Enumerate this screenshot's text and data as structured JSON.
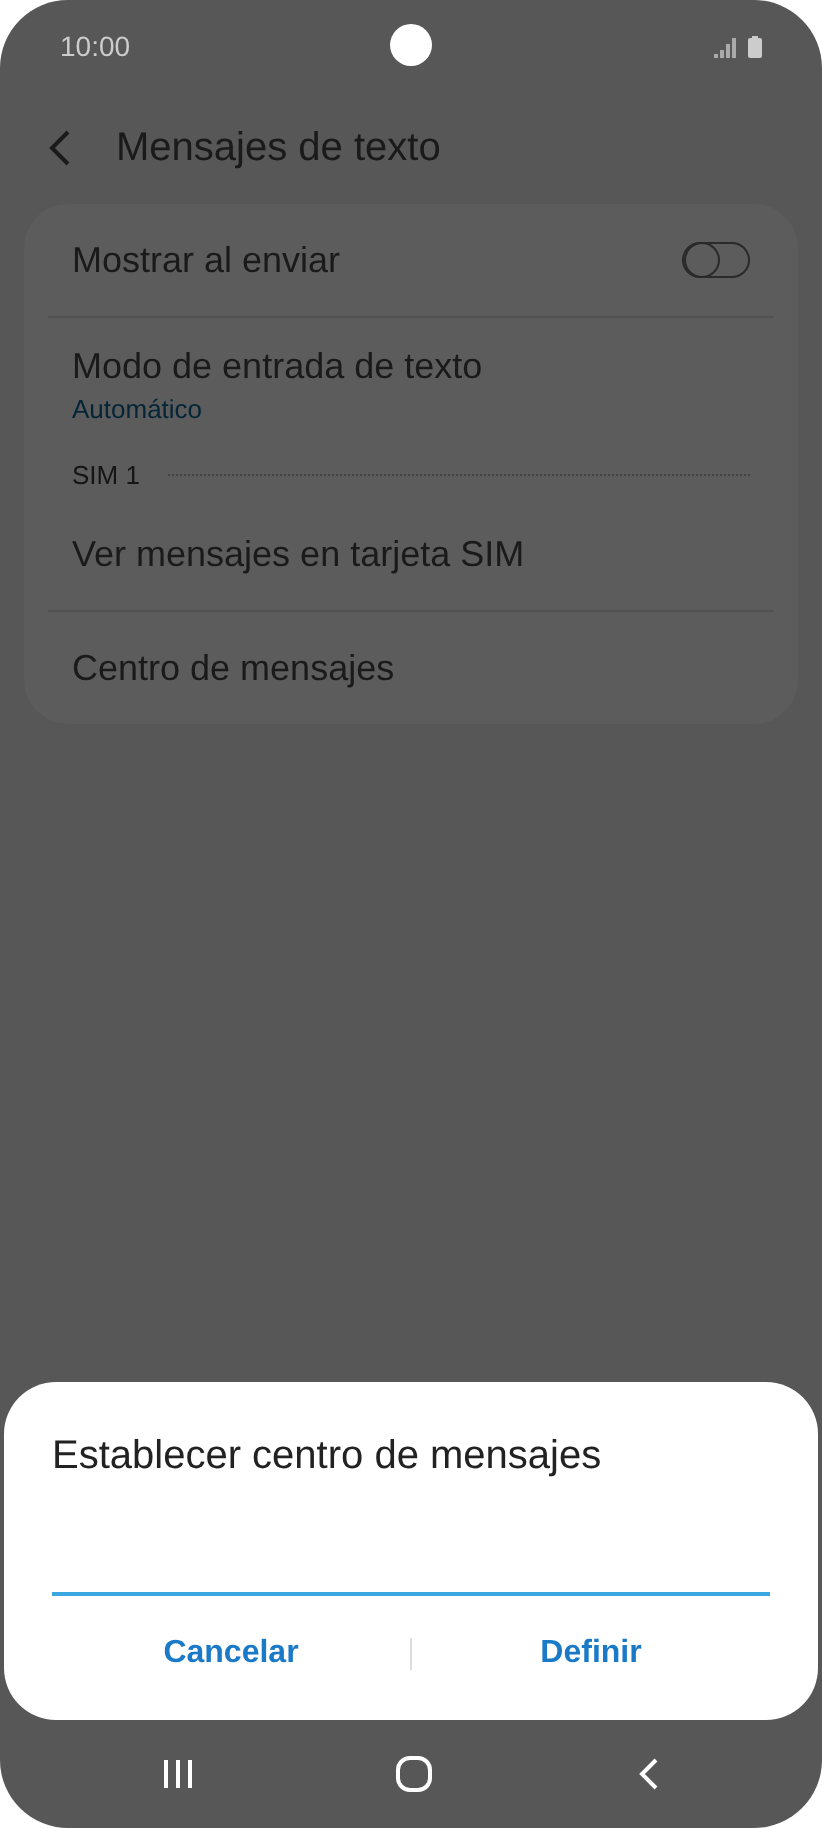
{
  "status_bar": {
    "time": "10:00"
  },
  "header": {
    "title": "Mensajes de texto"
  },
  "settings": [
    {
      "kind": "toggle",
      "label": "Mostrar al enviar",
      "on": false
    },
    {
      "kind": "subtitle",
      "label": "Modo de entrada de texto",
      "value": "Automático"
    },
    {
      "kind": "section",
      "label": "SIM 1"
    },
    {
      "kind": "plain",
      "label": "Ver mensajes en tarjeta SIM"
    },
    {
      "kind": "plain",
      "label": "Centro de mensajes"
    }
  ],
  "dialog": {
    "title": "Establecer centro de mensajes",
    "buttons": [
      "Cancelar",
      "Definir"
    ]
  }
}
